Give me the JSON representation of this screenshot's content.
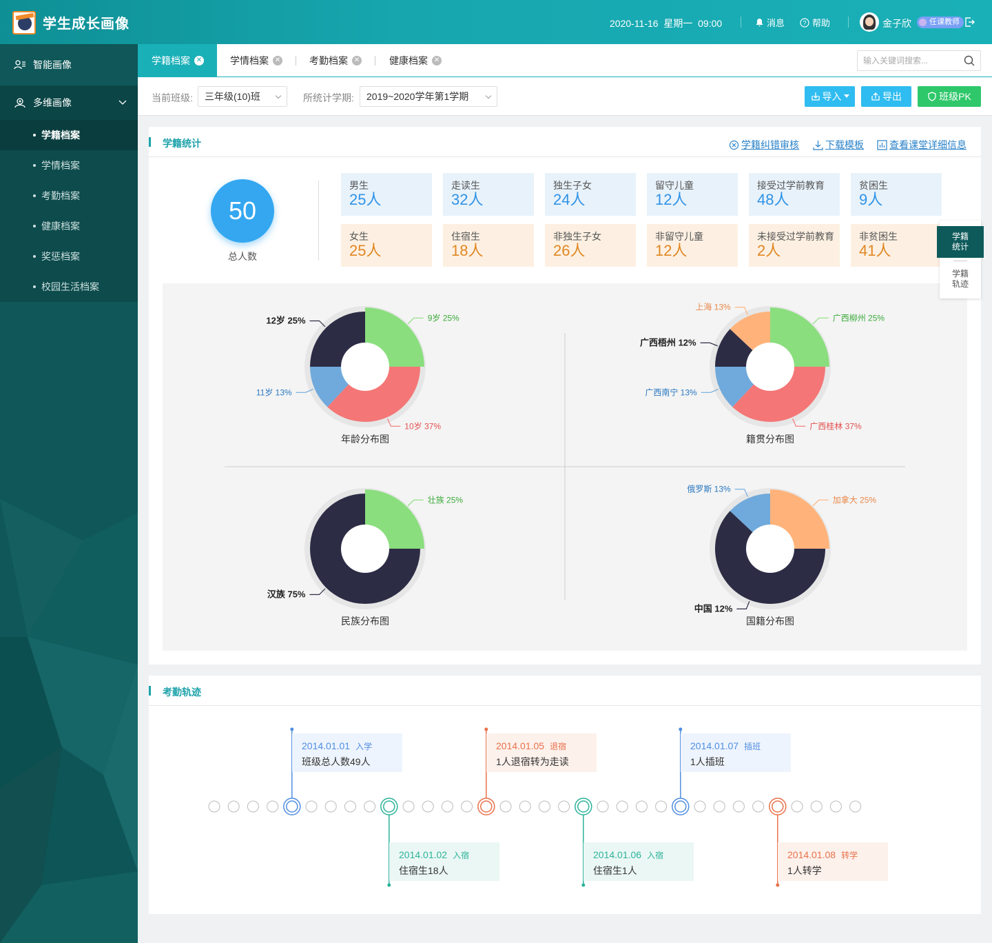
{
  "app": {
    "title": "学生成长画像"
  },
  "header": {
    "date": "2020-11-16",
    "weekday": "星期一",
    "time": "09:00",
    "message_label": "消息",
    "help_label": "帮助",
    "user_name": "金子欣",
    "user_role": "任课教师"
  },
  "sidebar": {
    "top_item": "智能画像",
    "group": "多维画像",
    "items": [
      {
        "label": "学籍档案",
        "active": true
      },
      {
        "label": "学情档案",
        "active": false
      },
      {
        "label": "考勤档案",
        "active": false
      },
      {
        "label": "健康档案",
        "active": false
      },
      {
        "label": "奖惩档案",
        "active": false
      },
      {
        "label": "校园生活档案",
        "active": false
      }
    ]
  },
  "tabs": [
    {
      "label": "学籍档案",
      "active": true
    },
    {
      "label": "学情档案",
      "active": false
    },
    {
      "label": "考勤档案",
      "active": false
    },
    {
      "label": "健康档案",
      "active": false
    }
  ],
  "search": {
    "placeholder": "输入关键词搜索..."
  },
  "filters": {
    "class_label": "当前班级:",
    "class_value": "三年级(10)班",
    "term_label": "所统计学期:",
    "term_value": "2019~2020学年第1学期"
  },
  "toolbar": {
    "import_label": "导入",
    "export_label": "导出",
    "pk_label": "班级PK"
  },
  "colors": {
    "teal": "#1ab0b8",
    "blue_btn": "#2fbcf0",
    "green_btn": "#2ec86a",
    "green": "#8ade7e",
    "dark": "#2c2c45",
    "red": "#f47676",
    "lightblue": "#70aadc",
    "orange": "#ffb37a"
  },
  "stats_card": {
    "title": "学籍统计",
    "links": [
      "学籍纠错审核",
      "下载模板",
      "查看课堂详细信息"
    ],
    "total_value": "50",
    "total_label": "总人数",
    "row1": [
      {
        "label": "男生",
        "value": "25人"
      },
      {
        "label": "走读生",
        "value": "32人"
      },
      {
        "label": "独生子女",
        "value": "24人"
      },
      {
        "label": "留守儿童",
        "value": "12人"
      },
      {
        "label": "接受过学前教育",
        "value": "48人"
      },
      {
        "label": "贫困生",
        "value": "9人"
      }
    ],
    "row2": [
      {
        "label": "女生",
        "value": "25人"
      },
      {
        "label": "住宿生",
        "value": "18人"
      },
      {
        "label": "非独生子女",
        "value": "26人"
      },
      {
        "label": "非留守儿童",
        "value": "12人"
      },
      {
        "label": "未接受过学前教育",
        "value": "2人"
      },
      {
        "label": "非贫困生",
        "value": "41人"
      }
    ]
  },
  "float_nav": {
    "active": "学籍统计",
    "other": "学籍轨迹"
  },
  "chart_data": [
    {
      "type": "pie",
      "title": "年龄分布图",
      "slices": [
        {
          "label": "9岁",
          "pct": "25%",
          "value": 25,
          "color": "#8ade7e"
        },
        {
          "label": "10岁",
          "pct": "37%",
          "value": 37,
          "color": "#f47676"
        },
        {
          "label": "11岁",
          "pct": "13%",
          "value": 13,
          "color": "#70aadc"
        },
        {
          "label": "12岁",
          "pct": "25%",
          "value": 25,
          "color": "#2c2c45"
        }
      ]
    },
    {
      "type": "pie",
      "title": "籍贯分布图",
      "slices": [
        {
          "label": "广西柳州",
          "pct": "25%",
          "value": 25,
          "color": "#8ade7e"
        },
        {
          "label": "广西桂林",
          "pct": "37%",
          "value": 37,
          "color": "#f47676"
        },
        {
          "label": "广西南宁",
          "pct": "13%",
          "value": 13,
          "color": "#70aadc"
        },
        {
          "label": "广西梧州",
          "pct": "12%",
          "value": 12,
          "color": "#2c2c45"
        },
        {
          "label": "上海",
          "pct": "13%",
          "value": 13,
          "color": "#ffb37a"
        }
      ]
    },
    {
      "type": "pie",
      "title": "民族分布图",
      "slices": [
        {
          "label": "壮族",
          "pct": "25%",
          "value": 25,
          "color": "#8ade7e"
        },
        {
          "label": "汉族",
          "pct": "75%",
          "value": 75,
          "color": "#2c2c45"
        }
      ]
    },
    {
      "type": "pie",
      "title": "国籍分布图",
      "slices": [
        {
          "label": "加拿大",
          "pct": "25%",
          "value": 25,
          "color": "#ffb37a"
        },
        {
          "label": "中国",
          "pct": "12%",
          "value": 62,
          "color": "#2c2c45"
        },
        {
          "label": "俄罗斯",
          "pct": "13%",
          "value": 13,
          "color": "#70aadc"
        }
      ]
    }
  ],
  "timeline_card": {
    "title": "考勤轨迹",
    "events": [
      {
        "date": "2014.01.01",
        "tag": "入学",
        "text": "班级总人数49人",
        "color": "blue"
      },
      {
        "date": "2014.01.02",
        "tag": "入宿",
        "text": "住宿生18人",
        "color": "green"
      },
      {
        "date": "2014.01.05",
        "tag": "退宿",
        "text": "1人退宿转为走读",
        "color": "red"
      },
      {
        "date": "2014.01.06",
        "tag": "入宿",
        "text": "住宿生1人",
        "color": "green"
      },
      {
        "date": "2014.01.07",
        "tag": "插班",
        "text": "1人插班",
        "color": "blue"
      },
      {
        "date": "2014.01.08",
        "tag": "转学",
        "text": "1人转学",
        "color": "red"
      }
    ]
  }
}
